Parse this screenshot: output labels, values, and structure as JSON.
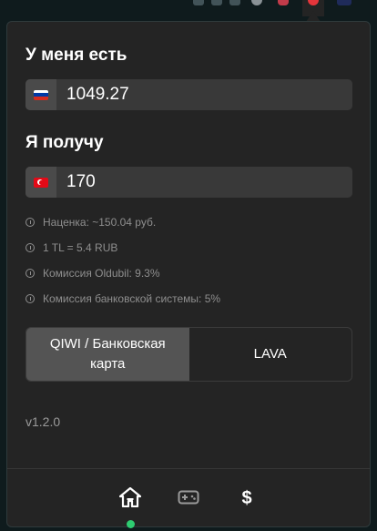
{
  "header": {
    "have_label": "У меня есть",
    "get_label": "Я получу"
  },
  "have": {
    "currency_flag": "ru-flag-icon",
    "value": "1049.27"
  },
  "get": {
    "currency_flag": "tr-flag-icon",
    "value": "170"
  },
  "info": [
    "Наценка: ~150.04 руб.",
    "1 TL = 5.4 RUB",
    "Комиссия Oldubil: 9.3%",
    "Комиссия банковской системы: 5%"
  ],
  "payment": {
    "option_1": "QIWI / Банковская карта",
    "option_2": "LAVA",
    "selected": "option_1"
  },
  "version": "v1.2.0",
  "nav": {
    "items": [
      "home-icon",
      "gamepad-icon",
      "dollar-icon"
    ],
    "active": "home-icon",
    "active_color": "#2ecc71"
  },
  "colors": {
    "popup_bg": "#242424",
    "field_bg": "#393939",
    "selected_option_bg": "#545454"
  }
}
